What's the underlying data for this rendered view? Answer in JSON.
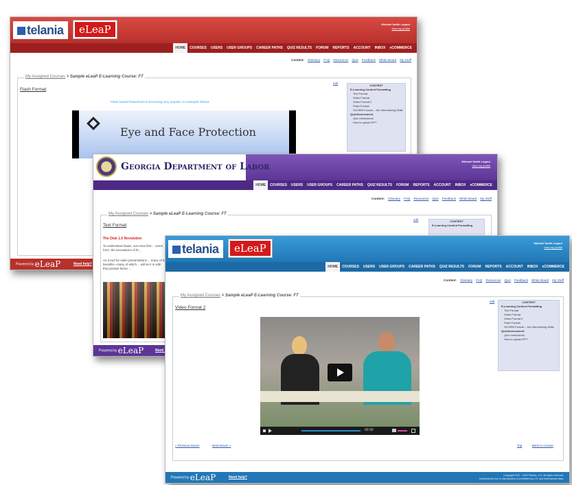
{
  "window1": {
    "logo_text": "telania",
    "eleap_text": "eLeaP",
    "user_name": "Michael Smith Logout",
    "user_sub": "view my profile",
    "nav": [
      "HOME",
      "COURSES",
      "USERS",
      "USER GROUPS",
      "CAREER PATHS",
      "QUIZ RESULTS",
      "FORUM",
      "REPORTS",
      "ACCOUNT",
      "INBOX",
      "eCOMMERCE"
    ],
    "submenu_label": "Content:",
    "submenu": [
      "Glossary",
      "FAQ",
      "Resources",
      "Quiz",
      "Feedback",
      "White Board",
      "My Stuff"
    ],
    "crumb_link": "My Assigned Courses",
    "crumb_course": "> Sample eLeaP E-Learning Course: FT",
    "page_title": "Flash Format",
    "caption": "Flash based PowerPoint is becoming very popular. An example follows",
    "slide_title": "Eye and Face Protection",
    "edit": "edit",
    "side": {
      "head": "CONTENT",
      "section": "E-Learning Content Formatting",
      "items": [
        "Text Format",
        "Video Format",
        "Video Format 2",
        "Flash Format",
        "SCORM Format – Job Interviewing Skills"
      ],
      "section2": "Quiz/Assessment",
      "items2": [
        "Quiz Instructions",
        "How to upload PPT"
      ]
    },
    "footer_powered": "Powered by",
    "footer_logo": "eLeaP",
    "footer_help": "Need help?",
    "theme": "#c0282a"
  },
  "window2": {
    "org_name": "Georgia Department of Labor",
    "user_name": "Michael Smith Logout",
    "user_sub": "view my profile",
    "nav": [
      "HOME",
      "COURSES",
      "USERS",
      "USER GROUPS",
      "CAREER PATHS",
      "QUIZ RESULTS",
      "FORUM",
      "REPORTS",
      "ACCOUNT",
      "INBOX",
      "eCOMMERCE"
    ],
    "submenu_label": "Content:",
    "submenu": [
      "Glossary",
      "FAQ",
      "Resources",
      "Quiz",
      "Feedback",
      "White Board",
      "My Stuff"
    ],
    "crumb_link": "My Assigned Courses",
    "crumb_course": "> Sample eLeaP E-Learning Course: FT",
    "page_title": "Text Format",
    "subhead": "The Disk 1.0 Revolution",
    "body1": "To understand DaaS, one must first… some form, the innovations of th…",
    "body2": "As a tool for sales presentations… many of its benefits—many of which… will tie it in with this positive factor…",
    "edit": "edit",
    "side": {
      "head": "CONTENT",
      "section": "E-Learning Content Formatting"
    },
    "footer_powered": "Powered by",
    "footer_logo": "eLeaP",
    "footer_help": "Need help?",
    "theme": "#6a3fa8"
  },
  "window3": {
    "logo_text": "telania",
    "eleap_text": "eLeaP",
    "user_name": "Michael Smith Logout",
    "user_sub": "view my profile",
    "nav": [
      "HOME",
      "COURSES",
      "USERS",
      "USER GROUPS",
      "CAREER PATHS",
      "QUIZ RESULTS",
      "FORUM",
      "REPORTS",
      "ACCOUNT",
      "INBOX",
      "eCOMMERCE"
    ],
    "submenu_label": "Content:",
    "submenu": [
      "Glossary",
      "FAQ",
      "Resources",
      "Quiz",
      "Feedback",
      "White Board",
      "My Stuff"
    ],
    "crumb_link": "My Assigned Courses",
    "crumb_course": "> Sample eLeaP E-Learning Course: FT",
    "page_title": "Video Format 2",
    "edit": "edit",
    "video_time": "00:00",
    "prev_link": "« Previous lesson",
    "next_link": "Next lesson »",
    "top_link": "Top",
    "back_link": "Back to Course",
    "side": {
      "head": "CONTENT",
      "section": "E-Learning Content Formatting",
      "items": [
        "Text Format",
        "Video Format",
        "Video Format 2",
        "Flash Format",
        "SCORM Format – Job Interviewing Skills"
      ],
      "section2": "Quiz/Assessment",
      "items2": [
        "Quiz Instructions",
        "How to upload PPT"
      ]
    },
    "footer_powered": "Powered by",
    "footer_logo": "eLeaP",
    "footer_help": "Need help?",
    "copyright": "Copyright 2011 - 2025 Telania, LLC. All rights reserved.",
    "copyright2": "Unauthorized use or reproduction is prohibited by U.S. and international laws.",
    "theme": "#2a85c4"
  }
}
